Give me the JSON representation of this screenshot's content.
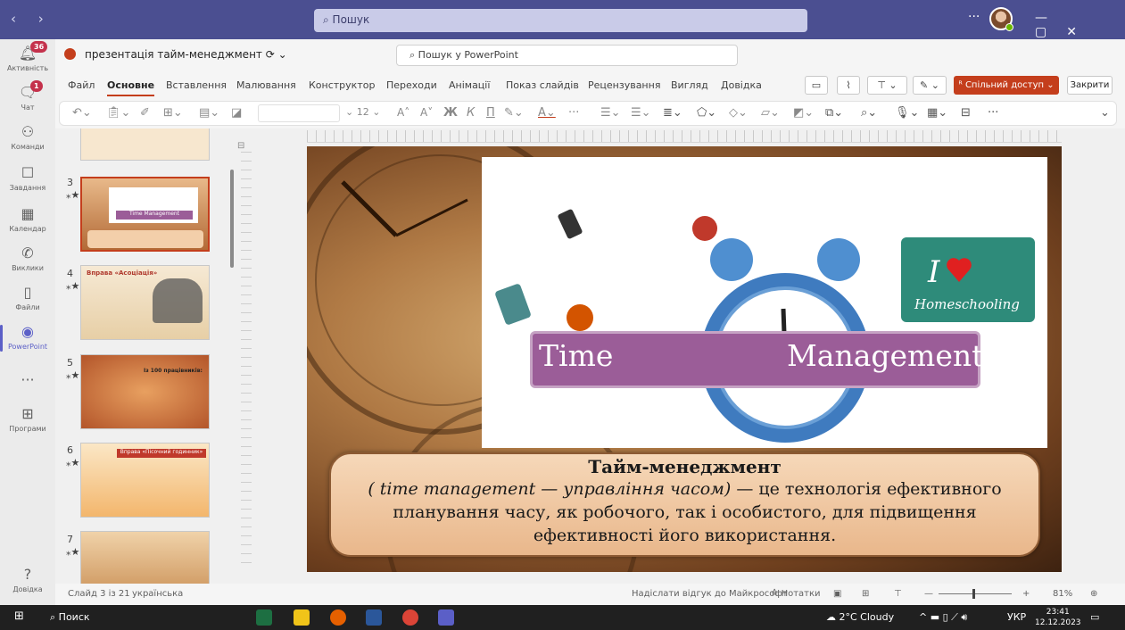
{
  "teams": {
    "search_placeholder": "Пошук",
    "rail": [
      {
        "label": "Активність",
        "icon": "bell-icon",
        "badge": "36"
      },
      {
        "label": "Чат",
        "icon": "chat-icon",
        "badge": "1"
      },
      {
        "label": "Команди",
        "icon": "teams-icon"
      },
      {
        "label": "Завдання",
        "icon": "tasks-icon"
      },
      {
        "label": "Календар",
        "icon": "calendar-icon"
      },
      {
        "label": "Виклики",
        "icon": "phone-icon"
      },
      {
        "label": "Файли",
        "icon": "file-icon"
      },
      {
        "label": "PowerPoint",
        "icon": "powerpoint-icon"
      },
      {
        "label": "...",
        "icon": "more-icon"
      },
      {
        "label": "Програми",
        "icon": "apps-icon"
      },
      {
        "label": "Довідка",
        "icon": "help-icon"
      }
    ]
  },
  "document": {
    "title": "презентація тайм-менеджмент",
    "search_placeholder": "Пошук у PowerPoint"
  },
  "menu": {
    "items": [
      "Файл",
      "Основне",
      "Вставлення",
      "Малювання",
      "Конструктор",
      "Переходи",
      "Анімації",
      "Показ слайдів",
      "Рецензування",
      "Вигляд",
      "Довідка"
    ],
    "active": "Основне",
    "share_label": "Спільний доступ",
    "close_label": "Закрити"
  },
  "ribbon": {
    "font_size": "12"
  },
  "thumbnails": [
    {
      "number": "3",
      "title": "Time Management"
    },
    {
      "number": "4",
      "title": "Вправа «Асоціація»"
    },
    {
      "number": "5",
      "title": "Із 100 працівників:"
    },
    {
      "number": "6",
      "title": "Вправа «Пісочний годинник»"
    },
    {
      "number": "7",
      "title": ""
    }
  ],
  "slide": {
    "banner_left": "Time",
    "banner_right": "Management",
    "caption_heading": "Тайм-менеджмент",
    "caption_italic": "( time management — управління часом)",
    "caption_rest": " — це технологія ефективного планування часу, як робочого, так і особистого, для підвищення ефективності його використання."
  },
  "status": {
    "slide_counter": "Слайд 3 із 21",
    "language": "українська",
    "feedback": "Надіслати відгук до Майкрософт",
    "notes": "Нотатки",
    "zoom": "81%"
  },
  "taskbar": {
    "search_label": "Поиск",
    "weather": "2°C Cloudy",
    "lang": "УКР",
    "time": "23:41",
    "date": "12.12.2023"
  },
  "colors": {
    "teams_header": "#4b4f91",
    "accent": "#c43e1c",
    "banner": "#9b5d98"
  }
}
